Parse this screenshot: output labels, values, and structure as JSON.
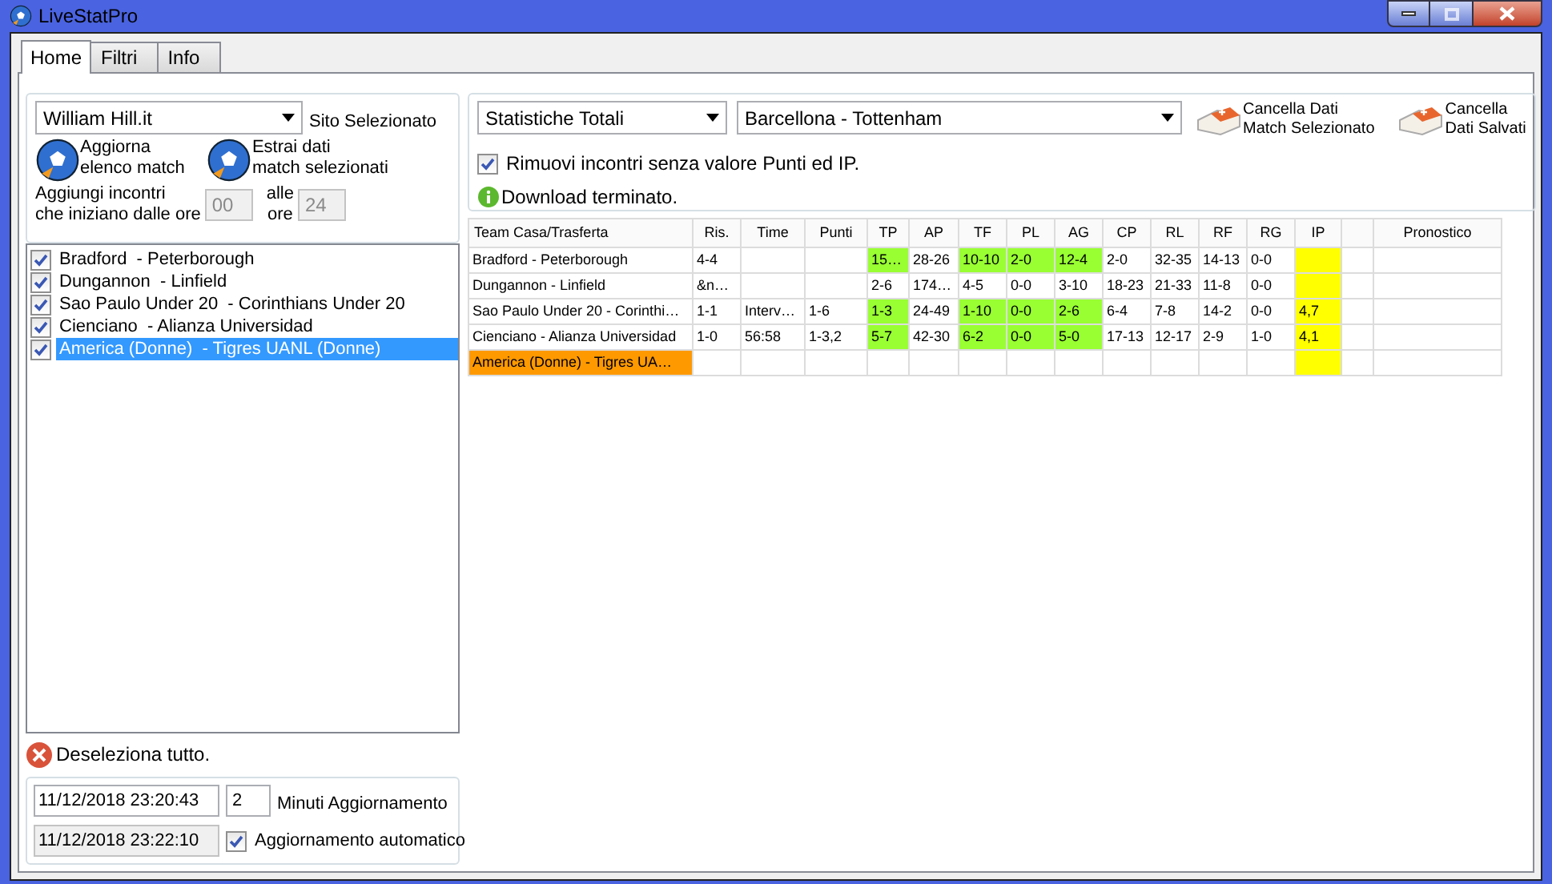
{
  "window": {
    "title": "LiveStatPro"
  },
  "tabs": [
    {
      "label": "Home",
      "selected": true
    },
    {
      "label": "Filtri",
      "selected": false
    },
    {
      "label": "Info",
      "selected": false
    }
  ],
  "site": {
    "value": "William Hill.it",
    "label": "Sito Selezionato"
  },
  "actions": [
    {
      "label": "Aggiorna\nelenco match"
    },
    {
      "label": "Estrai dati\nmatch selezionati"
    }
  ],
  "time_filter": {
    "label": "Aggiungi incontri\nche iniziano dalle ore",
    "from": "00",
    "to_label": "alle\nore",
    "to": "24"
  },
  "matches": [
    {
      "label": "Bradford  - Peterborough",
      "checked": true,
      "selected": false
    },
    {
      "label": "Dungannon  - Linfield",
      "checked": true,
      "selected": false
    },
    {
      "label": "Sao Paulo Under 20  - Corinthians Under 20",
      "checked": true,
      "selected": false
    },
    {
      "label": "Cienciano  - Alianza Universidad",
      "checked": true,
      "selected": false
    },
    {
      "label": "America (Donne)  - Tigres UANL (Donne)",
      "checked": true,
      "selected": true
    }
  ],
  "deselect_all": "Deseleziona tutto.",
  "update": {
    "last_update": "11/12/2018 23:20:43",
    "minutes": "2",
    "minutes_label": "Minuti Aggiornamento",
    "next_update": "11/12/2018 23:22:10",
    "auto_label": "Aggiornamento automatico",
    "auto_checked": true
  },
  "stats_select": "Statistiche Totali",
  "match_select": "Barcellona - Tottenham",
  "delete_buttons": [
    {
      "label": "Cancella Dati\nMatch Selezionato"
    },
    {
      "label": "Cancella\nDati Salvati"
    }
  ],
  "remove_option": {
    "label": "Rimuovi incontri senza valore Punti ed IP.",
    "checked": true
  },
  "status": "Download terminato.",
  "table": {
    "columns": [
      {
        "label": "Team Casa/Trasferta"
      },
      {
        "label": "Ris."
      },
      {
        "label": "Time"
      },
      {
        "label": "Punti"
      },
      {
        "label": "TP"
      },
      {
        "label": "AP"
      },
      {
        "label": "TF"
      },
      {
        "label": "PL"
      },
      {
        "label": "AG"
      },
      {
        "label": "CP"
      },
      {
        "label": "RL"
      },
      {
        "label": "RF"
      },
      {
        "label": "RG"
      },
      {
        "label": "IP"
      },
      {},
      {
        "label": "Pronostico"
      }
    ],
    "rows": [
      [
        {
          "text": "Bradford - Peterborough"
        },
        {
          "text": "4-4"
        },
        null,
        null,
        {
          "text": "15…",
          "color": "#99ff33"
        },
        {
          "text": "28-26"
        },
        {
          "text": "10-10",
          "color": "#99ff33"
        },
        {
          "text": "2-0",
          "color": "#99ff33"
        },
        {
          "text": "12-4",
          "color": "#99ff33"
        },
        {
          "text": "2-0"
        },
        {
          "text": "32-35"
        },
        {
          "text": "14-13"
        },
        {
          "text": "0-0"
        },
        {
          "color": "#ffff00"
        },
        null,
        null
      ],
      [
        {
          "text": "Dungannon - Linfield"
        },
        {
          "text": "&n…"
        },
        null,
        null,
        {
          "text": "2-6"
        },
        {
          "text": "174…"
        },
        {
          "text": "4-5"
        },
        {
          "text": "0-0"
        },
        {
          "text": "3-10"
        },
        {
          "text": "18-23"
        },
        {
          "text": "21-33"
        },
        {
          "text": "11-8"
        },
        {
          "text": "0-0"
        },
        {
          "color": "#ffff00"
        },
        null,
        null
      ],
      [
        {
          "text": "Sao Paulo Under 20 - Corinthi…"
        },
        {
          "text": "1-1"
        },
        {
          "text": "Interv…"
        },
        {
          "text": "1-6"
        },
        {
          "text": "1-3",
          "color": "#99ff33"
        },
        {
          "text": "24-49"
        },
        {
          "text": "1-10",
          "color": "#99ff33"
        },
        {
          "text": "0-0",
          "color": "#99ff33"
        },
        {
          "text": "2-6",
          "color": "#99ff33"
        },
        {
          "text": "6-4"
        },
        {
          "text": "7-8"
        },
        {
          "text": "14-2"
        },
        {
          "text": "0-0"
        },
        {
          "text": "4,7",
          "color": "#ffff00"
        },
        null,
        null
      ],
      [
        {
          "text": "Cienciano - Alianza Universidad"
        },
        {
          "text": "1-0"
        },
        {
          "text": "56:58"
        },
        {
          "text": "1-3,2"
        },
        {
          "text": "5-7",
          "color": "#99ff33"
        },
        {
          "text": "42-30"
        },
        {
          "text": "6-2",
          "color": "#99ff33"
        },
        {
          "text": "0-0",
          "color": "#99ff33"
        },
        {
          "text": "5-0",
          "color": "#99ff33"
        },
        {
          "text": "17-13"
        },
        {
          "text": "12-17"
        },
        {
          "text": "2-9"
        },
        {
          "text": "1-0"
        },
        {
          "text": "4,1",
          "color": "#ffff00"
        },
        null,
        null
      ],
      [
        {
          "text": "America (Donne) - Tigres UA…",
          "color": "#ff9900"
        },
        null,
        null,
        null,
        null,
        null,
        null,
        null,
        null,
        null,
        null,
        null,
        null,
        {
          "color": "#ffff00"
        },
        null,
        null
      ]
    ]
  }
}
